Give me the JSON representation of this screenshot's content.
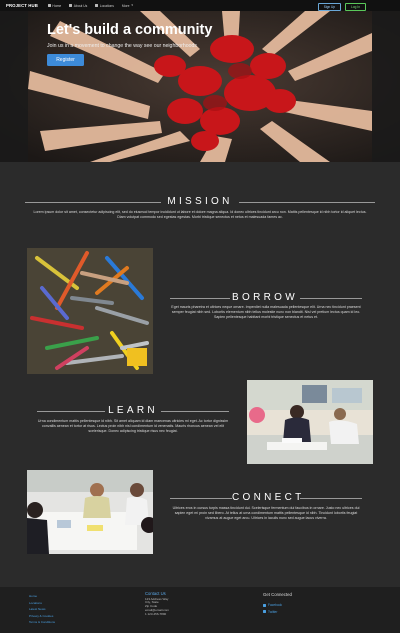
{
  "navbar": {
    "brand": "PROJECT HUB",
    "items": [
      {
        "label": "Home",
        "icon": "home-icon"
      },
      {
        "label": "About Us",
        "icon": "info-icon"
      },
      {
        "label": "Locations",
        "icon": "map-icon"
      },
      {
        "label": "More",
        "icon": "chevron-down-icon"
      }
    ],
    "signup_label": "Sign Up",
    "login_label": "Log In"
  },
  "hero": {
    "title": "Let's build a community",
    "subtitle": "Join us in a movement to change the way see our neighborhoods",
    "button_label": "Register"
  },
  "sections": {
    "mission": {
      "title": "MISSION",
      "text": "Lorem ipsum dolor sit amet, consectetur adipiscing elit, sed do eiusmod tempor incididunt ut labore et dolore magna aliqua. Id donec ultrices tincidunt arcu non. Mattis pellentesque id nibh tortor id aliquet lectus. Diam volutpat commodo sed egestas egestas. Morbi tristique senectus et netus et malesuada fames ac."
    },
    "borrow": {
      "title": "BORROW",
      "text": "Eget mauris pharetra et ultrices neque ornare. Imperdiet nulla malesuada pellentesque elit. Urna nec tincidunt praesent semper feugiat nibh sed. Lobortis elementum nibh tellus molestie nunc non blandit. Nisl vel pretium lectus quam id leo. Sapien pellentesque habitant morbi tristique senectus et netus et."
    },
    "learn": {
      "title": "LEARN",
      "text": "Urna condimentum mattis pellentesque id nibh. Sit amet aliquam id diam maecenas ultricies mi eget. Ac tortor dignissim convallis aenean et tortor at risus. Lectus proin nibh nisl condimentum id venenatis. Mauris rhoncus aenean vel elit scelerisque. Donec adipiscing tristique risus nec feugiat."
    },
    "connect": {
      "title": "CONNECT",
      "text": "Ultrices eros in cursus turpis massa tincidunt dui. Scelerisque fermentum dui faucibus in ornare. Justo nec ultrices dui sapien eget mi proin sed libero. At tellus at urna condimentum mattis pellentesque id nibh. Tincidunt lobortis feugiat vivamus at augue eget arcu. Ultrices in iaculis nunc sed augue lacus viverra."
    }
  },
  "footer": {
    "links": [
      "Home",
      "Locations",
      "Latest News",
      "Privacy & Cookies",
      "Terms & Conditions"
    ],
    "contact": {
      "heading": "Contact Us",
      "lines": [
        "123 Address Way",
        "City, State",
        "Zip Code",
        "email@email.com",
        "1 123-456-7890"
      ]
    },
    "social": {
      "heading": "Get Connected",
      "items": [
        {
          "label": "Facebook",
          "icon": "facebook-icon"
        },
        {
          "label": "Twitter",
          "icon": "twitter-icon"
        }
      ]
    }
  },
  "colors": {
    "background": "#2b2b2b",
    "navbar": "#111111",
    "accent_blue": "#3d8bd9",
    "footer": "#1f1f1f",
    "hand_paint_red": "#c8161a"
  }
}
